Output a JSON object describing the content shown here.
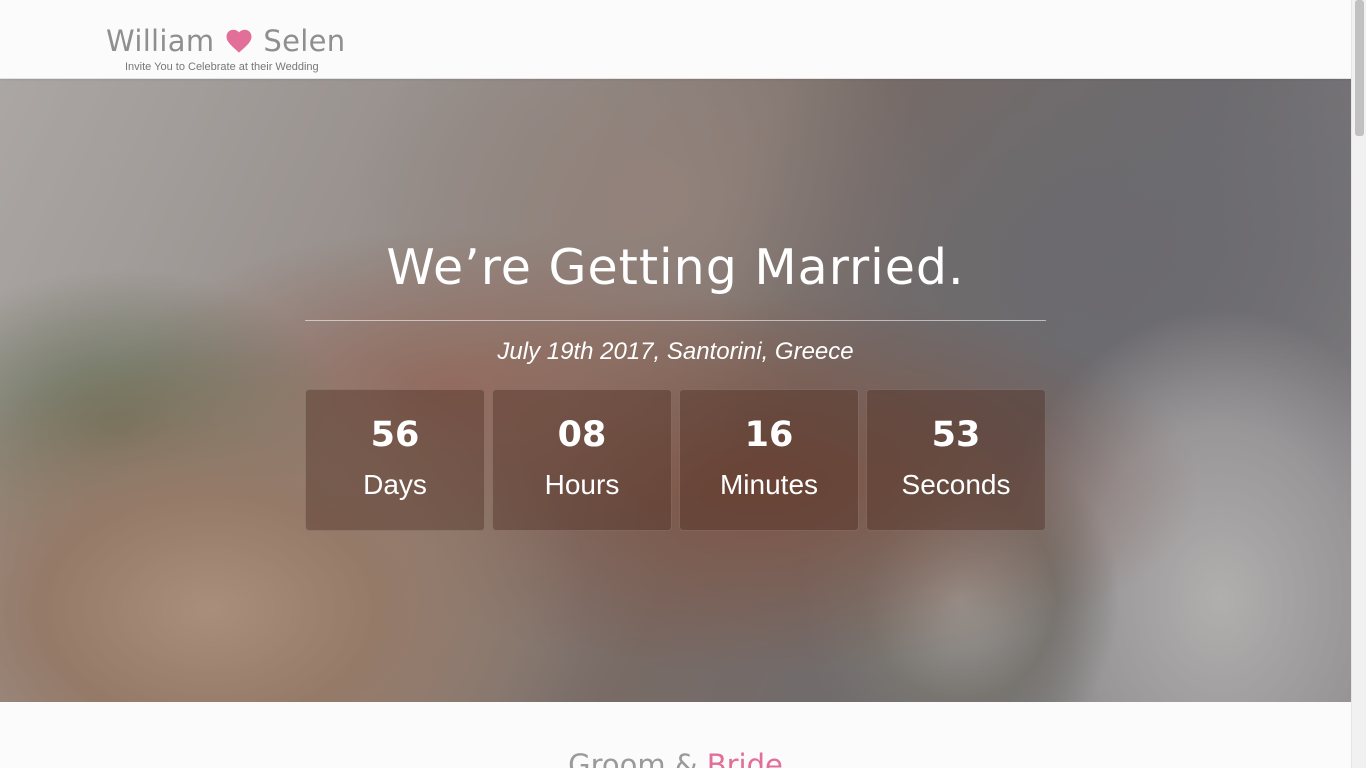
{
  "header": {
    "groom_name": "William",
    "bride_name": "Selen",
    "heart_icon": "heart-icon",
    "tagline": "Invite You to Celebrate at their Wedding",
    "accent_color": "#e16f98"
  },
  "hero": {
    "title": "We’re Getting Married.",
    "date_location": "July 19th 2017, Santorini, Greece"
  },
  "countdown": [
    {
      "value": "56",
      "label": "Days"
    },
    {
      "value": "08",
      "label": "Hours"
    },
    {
      "value": "16",
      "label": "Minutes"
    },
    {
      "value": "53",
      "label": "Seconds"
    }
  ],
  "section": {
    "title_part1": "Groom & ",
    "title_part2": "Bride"
  }
}
